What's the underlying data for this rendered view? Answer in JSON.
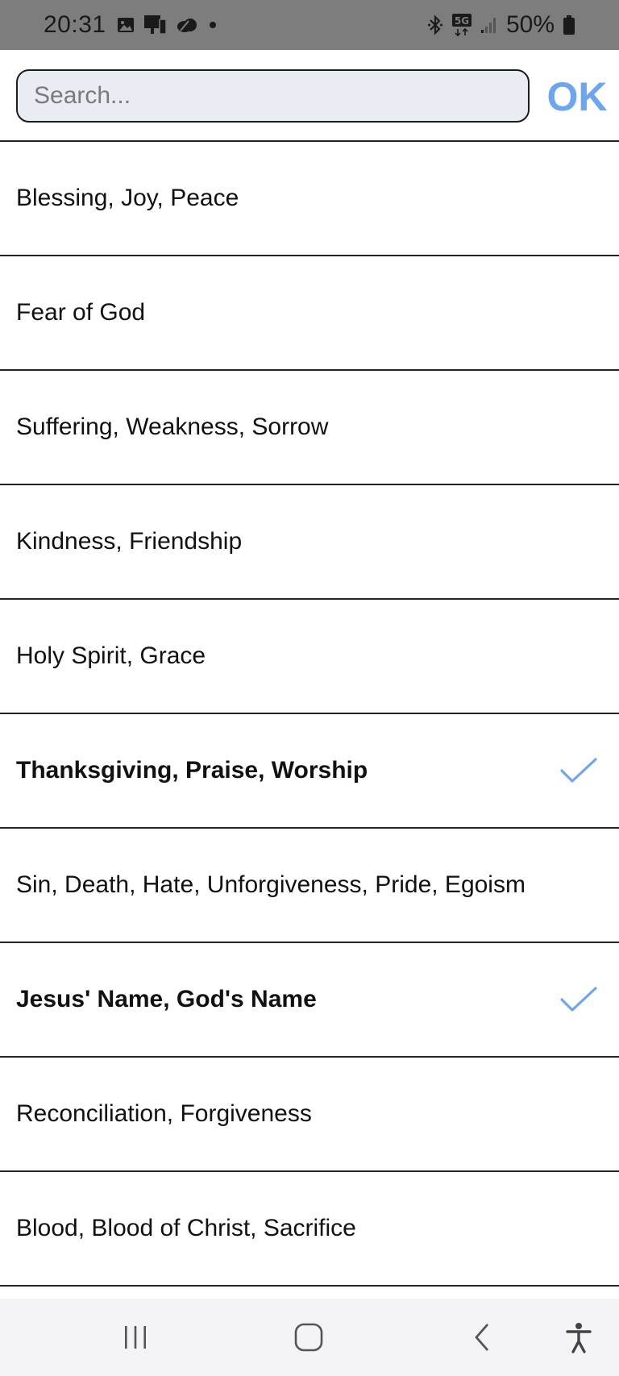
{
  "status_bar": {
    "time": "20:31",
    "battery": "50%",
    "network": "5G",
    "icons": [
      "gallery-icon",
      "device-icon",
      "cloud-icon",
      "dot-icon",
      "bluetooth-icon",
      "5g-icon",
      "signal-icon",
      "battery-icon"
    ]
  },
  "search": {
    "placeholder": "Search...",
    "value": ""
  },
  "ok_button": {
    "label": "OK"
  },
  "accent_color": "#6ea6ee",
  "categories": [
    {
      "label": "Blessing, Joy, Peace",
      "selected": false
    },
    {
      "label": "Fear of God",
      "selected": false
    },
    {
      "label": "Suffering, Weakness, Sorrow",
      "selected": false
    },
    {
      "label": "Kindness, Friendship",
      "selected": false
    },
    {
      "label": "Holy Spirit, Grace",
      "selected": false
    },
    {
      "label": "Thanksgiving, Praise, Worship",
      "selected": true
    },
    {
      "label": "Sin, Death, Hate, Unforgiveness, Pride, Egoism",
      "selected": false
    },
    {
      "label": "Jesus' Name, God's Name",
      "selected": true
    },
    {
      "label": "Reconciliation, Forgiveness",
      "selected": false
    },
    {
      "label": "Blood, Blood of Christ, Sacrifice",
      "selected": false
    }
  ],
  "nav_bar": {
    "icons": [
      "recent-apps-icon",
      "home-icon",
      "back-icon",
      "accessibility-icon"
    ]
  }
}
